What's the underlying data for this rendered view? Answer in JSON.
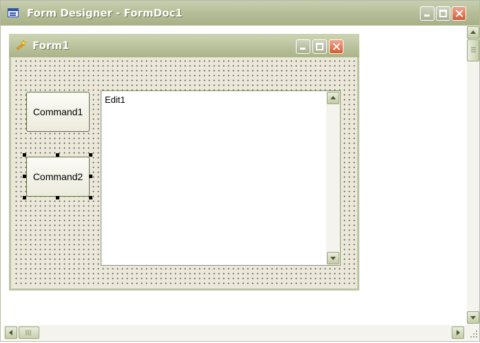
{
  "window": {
    "title": "Form Designer - FormDoc1"
  },
  "form": {
    "title": "Form1",
    "controls": {
      "command1": "Command1",
      "command2": "Command2",
      "edit1": "Edit1"
    }
  },
  "colors": {
    "title_bar": "#b7bf9a",
    "form_background": "#ebe8d9",
    "close_button": "#d45a34"
  }
}
